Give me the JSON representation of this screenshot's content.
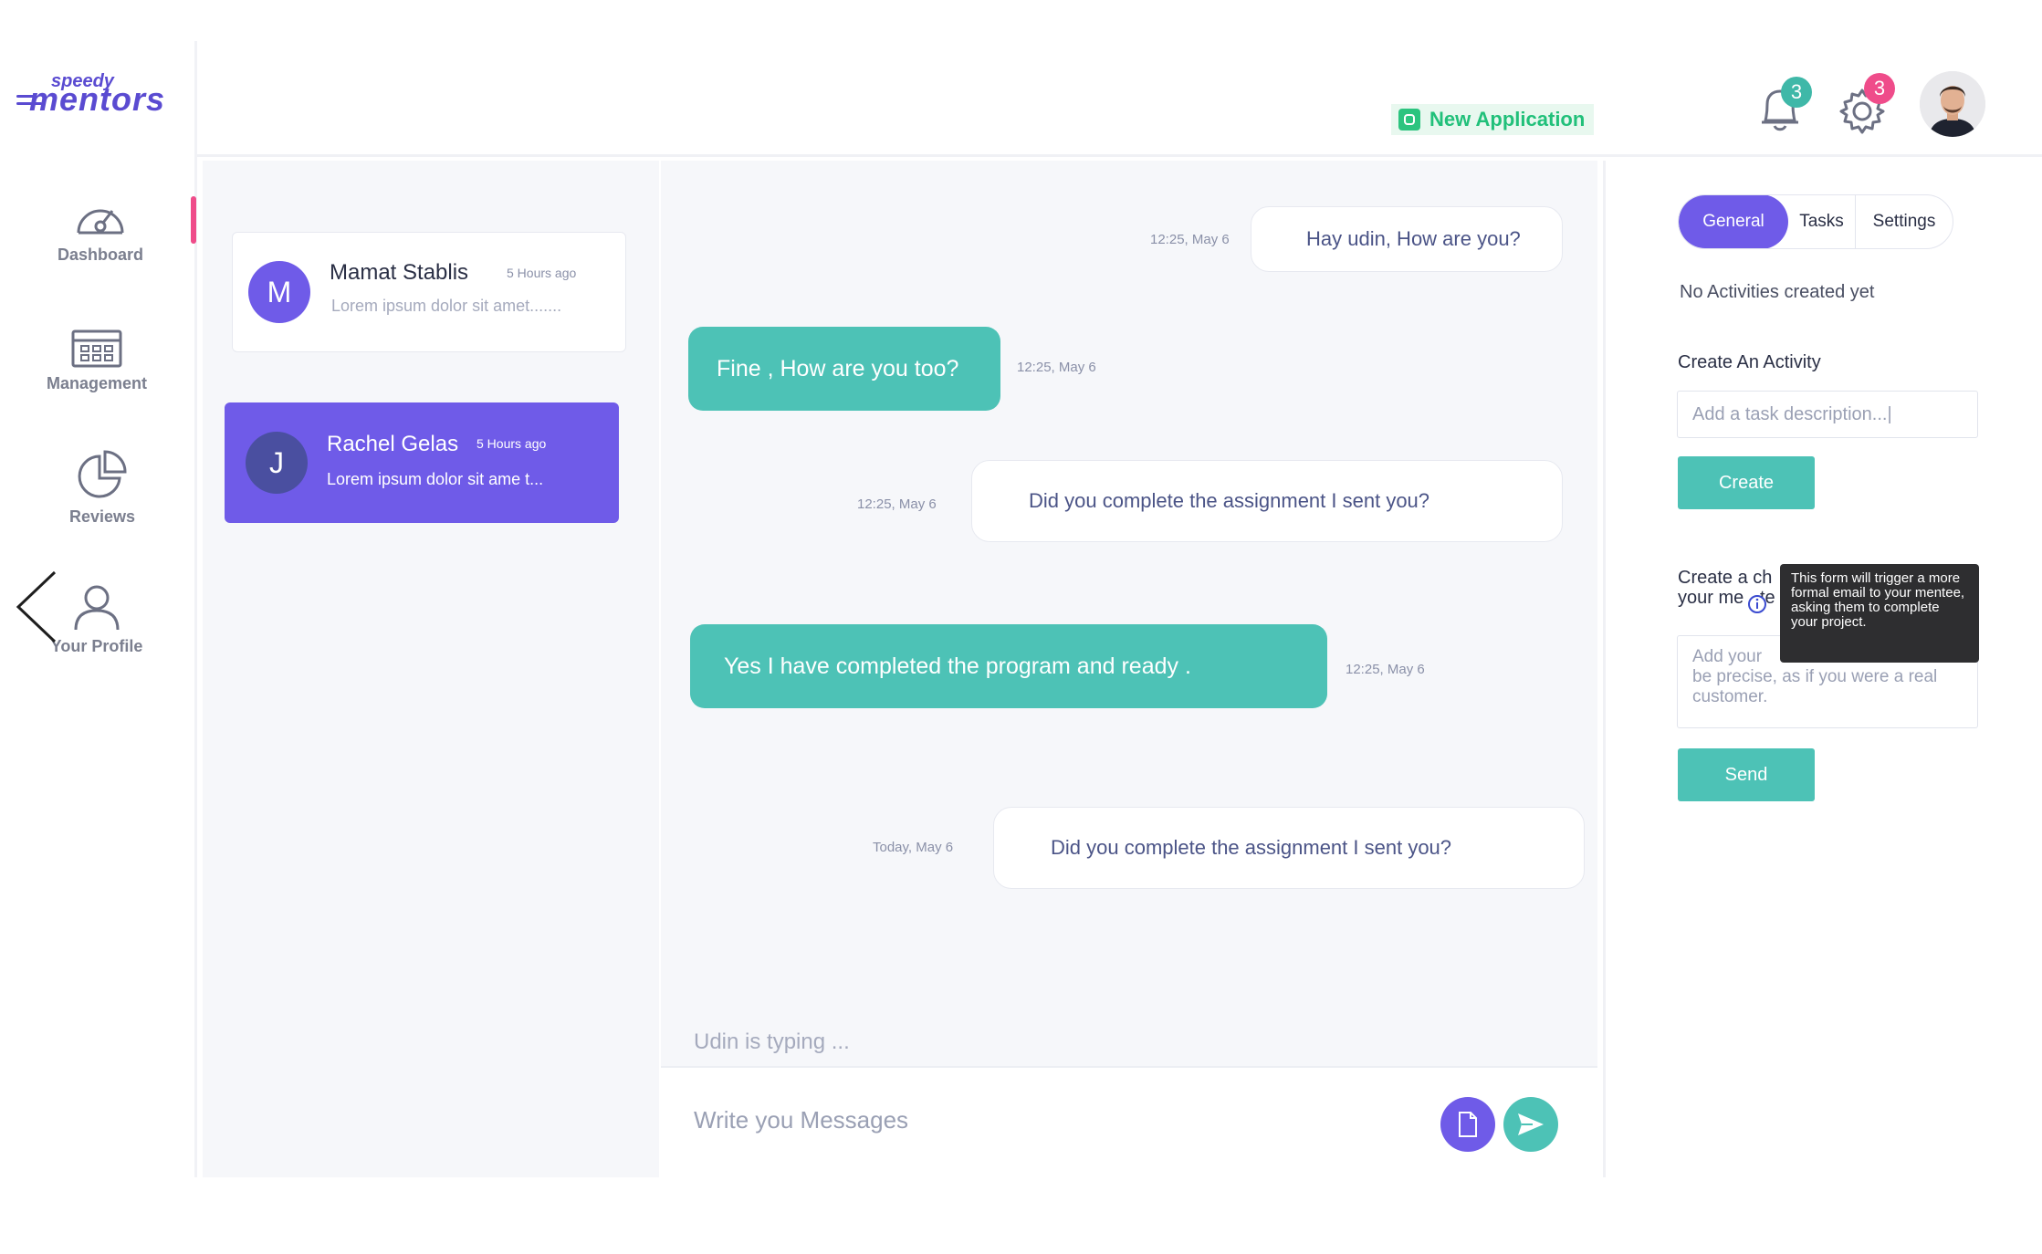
{
  "brand": {
    "top": "speedy",
    "main": "mentors"
  },
  "sidebar": {
    "items": [
      {
        "label": "Dashboard",
        "icon": "speedometer-icon"
      },
      {
        "label": "Management",
        "icon": "calendar-grid-icon"
      },
      {
        "label": "Reviews",
        "icon": "pie-chart-icon"
      },
      {
        "label": "Your Profile",
        "icon": "user-icon"
      }
    ]
  },
  "header": {
    "new_application": "New Application",
    "notifications_count": "3",
    "settings_count": "3"
  },
  "contacts": [
    {
      "initial": "M",
      "name": "Mamat Stablis",
      "time": "5 Hours ago",
      "preview": "Lorem ipsum dolor sit amet......."
    },
    {
      "initial": "J",
      "name": "Rachel Gelas",
      "time": "5 Hours ago",
      "preview": "Lorem ipsum dolor sit ame t..."
    }
  ],
  "messages": [
    {
      "dir": "in",
      "text": "Hay udin, How are you?",
      "time": "12:25,  May 6"
    },
    {
      "dir": "out",
      "text": "Fine , How are you too?",
      "time": "12:25,  May 6"
    },
    {
      "dir": "in",
      "text": "Did you complete the assignment I sent you?",
      "time": "12:25,  May 6"
    },
    {
      "dir": "out",
      "text": "Yes I have completed the program and ready .",
      "time": "12:25,  May 6"
    },
    {
      "dir": "in",
      "text": "Did you complete the assignment I sent you?",
      "time": "Today,  May 6"
    }
  ],
  "chat": {
    "typing": "Udin is typing ...",
    "composer_placeholder": "Write you Messages"
  },
  "panel": {
    "tabs": [
      "General",
      "Tasks",
      "Settings"
    ],
    "no_activities": "No Activities created yet",
    "create_activity_label": "Create An Activity",
    "task_placeholder": "Add a task description...|",
    "create_button": "Create",
    "form_label_line1": "Create a ch",
    "form_label_line2": "your me",
    "form_label_fragment": "te",
    "tooltip": "This form will trigger a more formal email to your mentee, asking them to complete your project.",
    "textarea_visible_start": "Add your",
    "textarea_visible_end": "be precise, as if you were a real customer.",
    "send_button": "Send"
  },
  "colors": {
    "accent": "#6f5be8",
    "teal": "#4dc2b6",
    "pink": "#ef4c8a",
    "green": "#21c07a"
  }
}
